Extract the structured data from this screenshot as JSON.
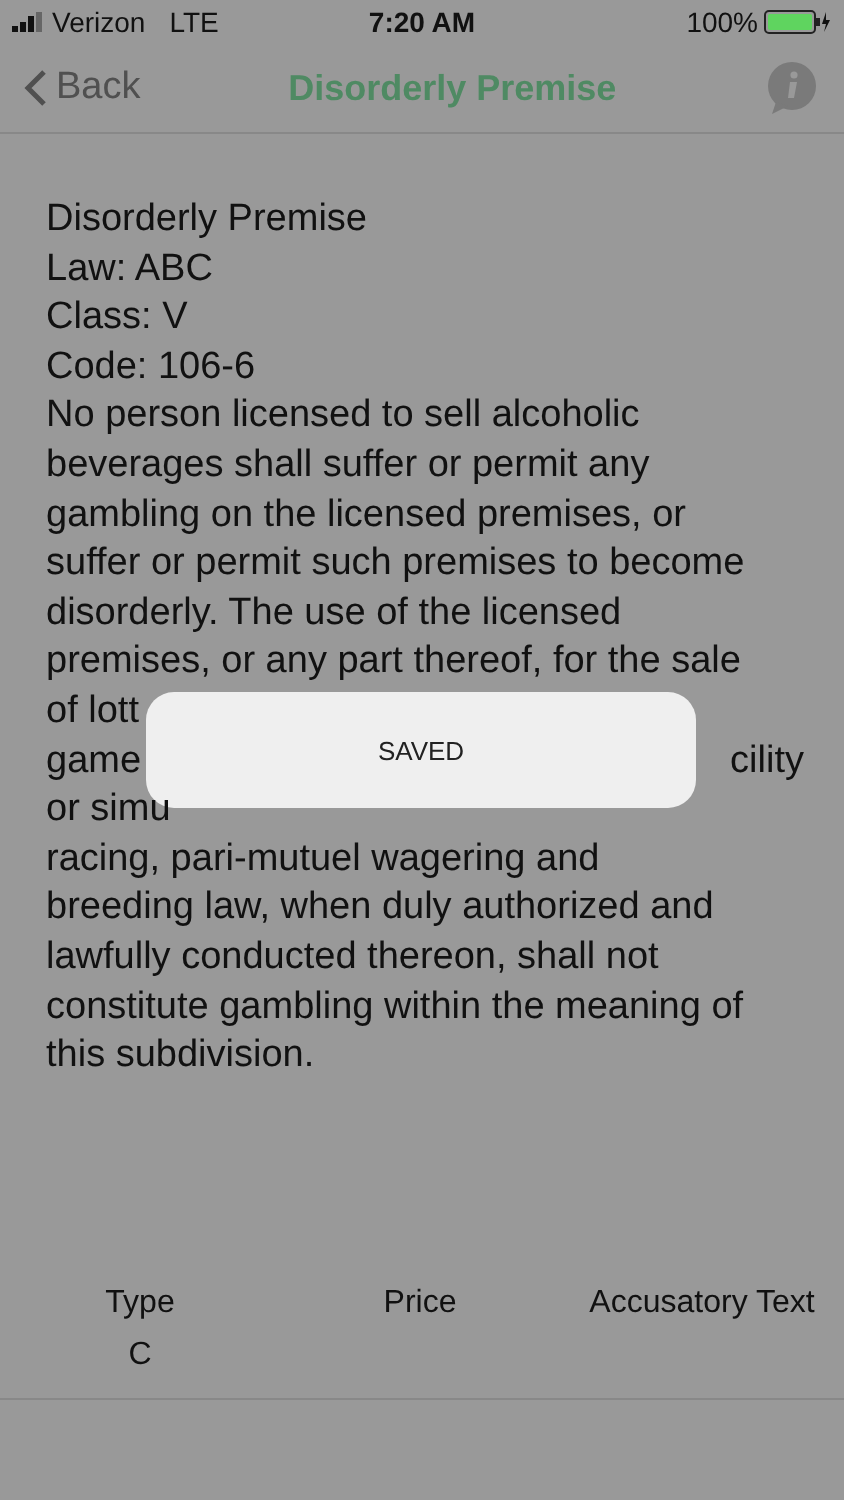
{
  "status_bar": {
    "carrier": "Verizon",
    "network": "LTE",
    "time": "7:20 AM",
    "battery": "100%"
  },
  "nav": {
    "back": "Back",
    "title": "Disorderly Premise"
  },
  "body_lines": [
    {
      "parts": [
        "Disorderly Premise"
      ]
    },
    {
      "parts": [
        "Law: ABC"
      ]
    },
    {
      "parts": [
        "Class: V"
      ]
    },
    {
      "parts": [
        "Code: 106-6"
      ]
    },
    {
      "parts": [
        "No person licensed to sell alcoholic"
      ]
    },
    {
      "parts": [
        "beverages shall suffer or permit any"
      ]
    },
    {
      "parts": [
        "gambling on the licensed premises, or"
      ]
    },
    {
      "parts": [
        "suffer or permit such premises to become"
      ]
    },
    {
      "parts": [
        "disorderly. The use of the licensed"
      ]
    },
    {
      "parts": [
        "premises, or any part thereof, for the sale"
      ]
    },
    {
      "parts": [
        "of lott"
      ]
    },
    {
      "parts": [
        "game",
        "cility"
      ]
    },
    {
      "parts": [
        "or simu"
      ]
    },
    {
      "parts": [
        "racing, pari-mutuel wagering and"
      ]
    },
    {
      "parts": [
        "breeding law, when duly authorized and"
      ]
    },
    {
      "parts": [
        "lawfully conducted thereon, shall not"
      ]
    },
    {
      "parts": [
        "constitute gambling within the meaning of"
      ]
    },
    {
      "parts": [
        "this subdivision."
      ]
    }
  ],
  "table": {
    "columns": [
      "Type",
      "Price",
      "Accusatory Text"
    ],
    "rows": [
      [
        "C",
        "",
        ""
      ]
    ]
  },
  "toast": {
    "text": "SAVED"
  }
}
